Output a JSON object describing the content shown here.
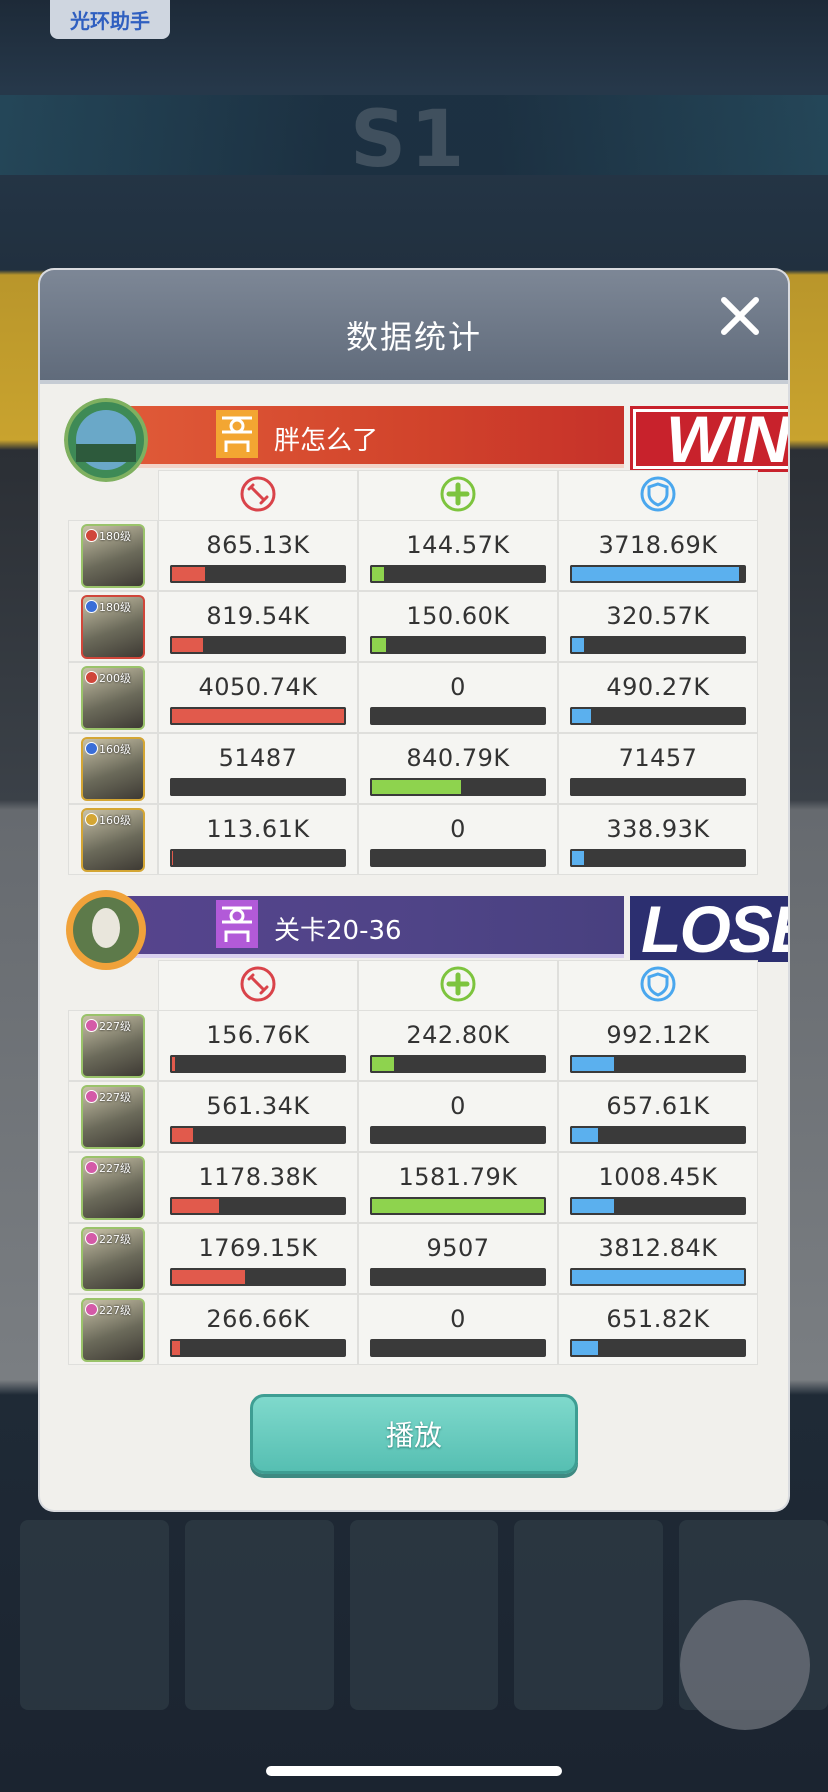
{
  "overlay": {
    "helper_label": "光环助手"
  },
  "background": {
    "season_text": "S1"
  },
  "modal": {
    "title": "数据统计",
    "play_label": "播放"
  },
  "colors": {
    "damage": "#e15a4c",
    "heal": "#8ed34e",
    "defense": "#5bb0ee",
    "win_badge": "#c8222c",
    "lose_badge": "#2c2f70"
  },
  "team1": {
    "name": "胖怎么了",
    "result": "WIN",
    "heroes": [
      {
        "level": "180级",
        "damage": "865.13K",
        "heal": "144.57K",
        "defense": "3718.69K",
        "damage_fill": 0.21,
        "heal_fill": 0.09,
        "defense_fill": 0.97,
        "lv_color": "#d0463a",
        "frame": "#9ac36a"
      },
      {
        "level": "180级",
        "damage": "819.54K",
        "heal": "150.60K",
        "defense": "320.57K",
        "damage_fill": 0.2,
        "heal_fill": 0.1,
        "defense_fill": 0.09,
        "lv_color": "#3a6ed8",
        "frame": "#d0463a"
      },
      {
        "level": "200级",
        "damage": "4050.74K",
        "heal": "0",
        "defense": "490.27K",
        "damage_fill": 1.0,
        "heal_fill": 0,
        "defense_fill": 0.13,
        "lv_color": "#d0463a",
        "frame": "#9ac36a"
      },
      {
        "level": "160级",
        "damage": "51487",
        "heal": "840.79K",
        "defense": "71457",
        "damage_fill": 0.02,
        "heal_fill": 0.53,
        "defense_fill": 0.02,
        "lv_color": "#3a6ed8",
        "frame": "#d4a634"
      },
      {
        "level": "160级",
        "damage": "113.61K",
        "heal": "0",
        "defense": "338.93K",
        "damage_fill": 0.03,
        "heal_fill": 0,
        "defense_fill": 0.09,
        "lv_color": "#d4a634",
        "frame": "#d4a634"
      }
    ]
  },
  "team2": {
    "name": "关卡20-36",
    "result": "LOSE",
    "heroes": [
      {
        "level": "227级",
        "damage": "156.76K",
        "heal": "242.80K",
        "defense": "992.12K",
        "damage_fill": 0.04,
        "heal_fill": 0.15,
        "defense_fill": 0.26,
        "lv_color": "#d45aa8",
        "frame": "#9ac36a"
      },
      {
        "level": "227级",
        "damage": "561.34K",
        "heal": "0",
        "defense": "657.61K",
        "damage_fill": 0.14,
        "heal_fill": 0,
        "defense_fill": 0.17,
        "lv_color": "#d45aa8",
        "frame": "#9ac36a"
      },
      {
        "level": "227级",
        "damage": "1178.38K",
        "heal": "1581.79K",
        "defense": "1008.45K",
        "damage_fill": 0.29,
        "heal_fill": 1.0,
        "defense_fill": 0.26,
        "lv_color": "#d45aa8",
        "frame": "#9ac36a"
      },
      {
        "level": "227级",
        "damage": "1769.15K",
        "heal": "9507",
        "defense": "3812.84K",
        "damage_fill": 0.44,
        "heal_fill": 0.01,
        "defense_fill": 1.0,
        "lv_color": "#d45aa8",
        "frame": "#9ac36a"
      },
      {
        "level": "227级",
        "damage": "266.66K",
        "heal": "0",
        "defense": "651.82K",
        "damage_fill": 0.07,
        "heal_fill": 0,
        "defense_fill": 0.17,
        "lv_color": "#d45aa8",
        "frame": "#9ac36a"
      }
    ]
  }
}
